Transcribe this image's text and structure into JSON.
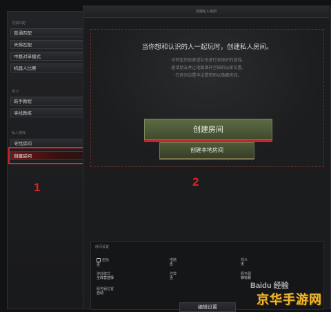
{
  "sidebar": {
    "section1_title": "寻找匹配",
    "matchmaking": [
      "普通匹配",
      "天梯匹配",
      "中路对单模式",
      "机器人比赛"
    ],
    "section2_title": "学习",
    "learn": [
      "新手教程",
      "寻找教练"
    ],
    "section3_title": "私人游戏",
    "private": [
      "寻找房间",
      "创建房间"
    ]
  },
  "markers": {
    "left": "1",
    "right": "2"
  },
  "main": {
    "header": "创建私人房间",
    "headline": "当你想和认识的人一起玩时，创建私人房间。",
    "desc": [
      "· 与特定的玩家或队伍进行安排好的游戏。",
      "· 邀请朋友并让电脑填补空缺的玩家位置。",
      "· 在房间设置中设置密码以隐藏房间。"
    ],
    "create_button": "创建房间",
    "create_local_button": "创建本地房间"
  },
  "settings": {
    "title": "房间设置",
    "fields": [
      {
        "label": "密码",
        "value": "否"
      },
      {
        "label": "电脑",
        "value": "否"
      },
      {
        "label": "观众",
        "value": "无"
      },
      {
        "label": "游戏模式",
        "value": "全阵营选择"
      },
      {
        "label": "作弊",
        "value": "否"
      },
      {
        "label": "服务器",
        "value": "锦标赛"
      },
      {
        "label": "服务器位置",
        "value": "自动"
      }
    ],
    "edit_button": "编辑设置"
  },
  "watermark": {
    "logo": "Baidu 经验",
    "site": "京华手游网"
  }
}
